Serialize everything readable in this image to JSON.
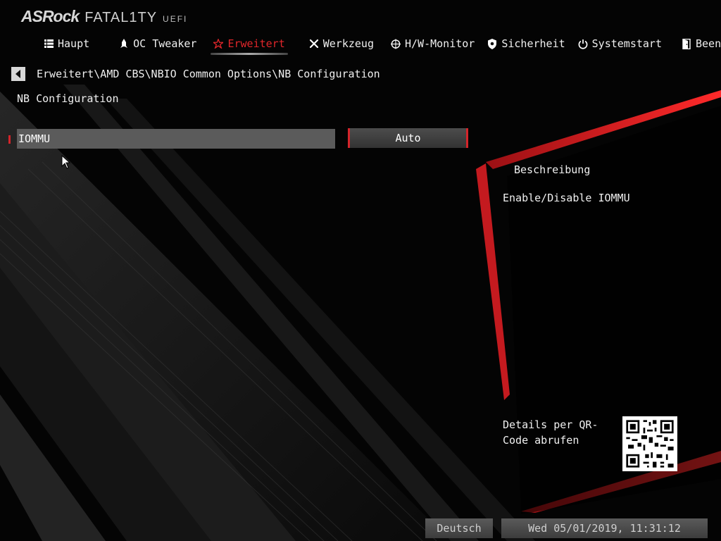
{
  "header": {
    "brand": "ASRock",
    "product": "FATAL1TY",
    "suffix": "UEFI"
  },
  "nav": {
    "tabs": [
      {
        "label": "Haupt",
        "icon": "list-icon"
      },
      {
        "label": "OC Tweaker",
        "icon": "rocket-icon"
      },
      {
        "label": "Erweitert",
        "icon": "star-icon",
        "active": true
      },
      {
        "label": "Werkzeug",
        "icon": "tools-icon"
      },
      {
        "label": "H/W-Monitor",
        "icon": "crosshair-icon"
      },
      {
        "label": "Sicherheit",
        "icon": "shield-icon"
      },
      {
        "label": "Systemstart",
        "icon": "power-icon"
      },
      {
        "label": "Beenden",
        "icon": "exit-door-icon"
      }
    ]
  },
  "breadcrumb": "Erweitert\\AMD CBS\\NBIO Common Options\\NB Configuration",
  "section_title": "NB Configuration",
  "options": [
    {
      "label": "IOMMU",
      "value": "Auto"
    }
  ],
  "description": {
    "title": "Beschreibung",
    "text": "Enable/Disable IOMMU",
    "qr_text": "Details per QR-Code abrufen"
  },
  "footer": {
    "language": "Deutsch",
    "datetime": "Wed 05/01/2019, 11:31:12"
  },
  "colors": {
    "accent": "#d4242a",
    "background": "#050505",
    "row": "#5b5b5b"
  }
}
